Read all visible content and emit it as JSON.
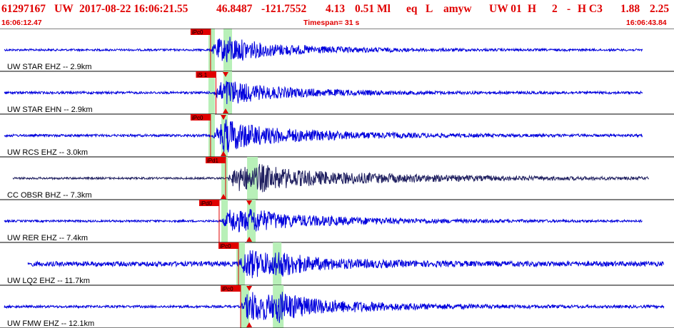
{
  "header": {
    "evid": "61297167",
    "network": "UW",
    "datetime": "2017-08-22 16:06:21.55",
    "lat": "46.8487",
    "lon": "-121.7552",
    "depth": "4.13",
    "magnitude": "0.51 Ml",
    "type": "eq",
    "etype_flag": "L",
    "author": "amyw",
    "subnet": "UW 01",
    "quality": "H",
    "num": "2",
    "dash": "-",
    "class": "H C3",
    "value_a": "1.88",
    "value_b": "2.25"
  },
  "time_row": {
    "start": "16:06:12.47",
    "span_label": "Timespan=  31 s",
    "end": "16:06:43.84"
  },
  "colors": {
    "header_text": "#e00000",
    "trace": "#0000dd",
    "trace_dark": "#202060",
    "window": "#b8f0b8",
    "pick": "#e00000",
    "divider": "#000000"
  },
  "chart_data": {
    "type": "line",
    "title": "",
    "xlabel": "",
    "ylabel": "",
    "x_unit": "seconds from 16:06:12.47",
    "xlim": [
      0,
      31.37
    ],
    "series": [
      {
        "name": "UW STAR EHZ -- 2.9km",
        "trace_start": 0.2,
        "trace_end": 29.9,
        "onset": 9.8,
        "s_onset": 10.5,
        "noise": 0.05,
        "peak": 0.55,
        "decay": 3.5,
        "dark": false,
        "picks": [
          {
            "label": "iPc0",
            "t": 9.8
          }
        ],
        "markers": [],
        "windows": [
          [
            9.7,
            10.0
          ],
          [
            10.4,
            10.8
          ]
        ]
      },
      {
        "name": "UW STAR EHN -- 2.9km",
        "trace_start": 0.2,
        "trace_end": 29.9,
        "onset": 9.9,
        "s_onset": 10.5,
        "noise": 0.06,
        "peak": 0.5,
        "decay": 3.5,
        "dark": false,
        "picks": [
          {
            "label": "iS 1",
            "t": 10.05
          }
        ],
        "markers": [
          10.5
        ],
        "windows": [
          [
            9.7,
            10.0
          ],
          [
            10.4,
            10.8
          ]
        ]
      },
      {
        "name": "UW RCS EHZ -- 3.0km",
        "trace_start": 0.2,
        "trace_end": 29.9,
        "onset": 9.9,
        "s_onset": 10.4,
        "noise": 0.06,
        "peak": 0.65,
        "decay": 4.0,
        "dark": false,
        "picks": [
          {
            "label": "iPc0",
            "t": 9.8
          }
        ],
        "markers": [
          10.4
        ],
        "windows": [
          [
            9.7,
            10.0
          ],
          [
            10.3,
            10.6
          ]
        ]
      },
      {
        "name": "CC OBSR BHZ -- 7.3km",
        "trace_start": 0.6,
        "trace_end": 30.2,
        "onset": 10.6,
        "s_onset": 12.0,
        "noise": 0.05,
        "peak": 0.6,
        "decay": 6.0,
        "dark": true,
        "picks": [
          {
            "label": "iPd1",
            "t": 10.5
          }
        ],
        "markers": [
          10.4
        ],
        "windows": [
          [
            10.3,
            10.6
          ],
          [
            11.5,
            12.0
          ]
        ]
      },
      {
        "name": "UW RER EHZ -- 7.4km",
        "trace_start": 0.2,
        "trace_end": 29.9,
        "onset": 10.3,
        "s_onset": 11.6,
        "noise": 0.05,
        "peak": 0.55,
        "decay": 4.5,
        "dark": false,
        "picks": [
          {
            "label": "iPd0",
            "t": 10.2
          }
        ],
        "markers": [
          11.6
        ],
        "windows": [
          [
            10.3,
            10.6
          ],
          [
            11.5,
            11.9
          ]
        ]
      },
      {
        "name": "UW LQ2 EHZ -- 11.7km",
        "trace_start": 1.3,
        "trace_end": 30.9,
        "onset": 11.1,
        "s_onset": 12.8,
        "noise": 0.12,
        "peak": 0.65,
        "decay": 3.0,
        "dark": false,
        "picks": [
          {
            "label": "iPc0",
            "t": 11.1
          }
        ],
        "markers": [],
        "windows": [
          [
            11.0,
            11.4
          ],
          [
            12.7,
            13.1
          ]
        ]
      },
      {
        "name": "UW FMW EHZ -- 12.1km",
        "trace_start": 0.2,
        "trace_end": 30.9,
        "onset": 11.2,
        "s_onset": 12.8,
        "noise": 0.06,
        "peak": 0.75,
        "decay": 4.0,
        "dark": false,
        "picks": [
          {
            "label": "iPc0",
            "t": 11.2
          }
        ],
        "markers": [
          11.6
        ],
        "windows": [
          [
            11.2,
            11.6
          ],
          [
            12.7,
            13.2
          ]
        ]
      }
    ]
  }
}
